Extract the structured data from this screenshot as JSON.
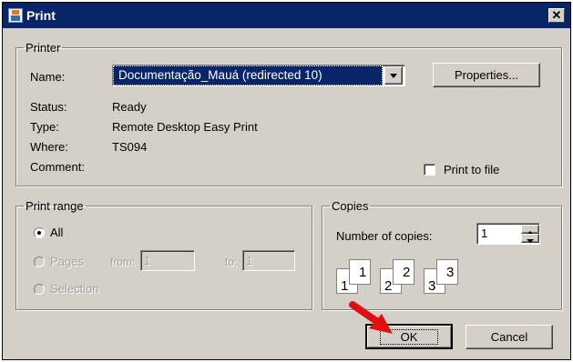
{
  "window": {
    "title": "Print",
    "close_glyph": "✕"
  },
  "printer": {
    "legend": "Printer",
    "name_label": "Name:",
    "name_value": "Documentação_Mauá (redirected 10)",
    "properties_button": "Properties...",
    "status_label": "Status:",
    "status_value": "Ready",
    "type_label": "Type:",
    "type_value": "Remote Desktop Easy Print",
    "where_label": "Where:",
    "where_value": "TS094",
    "comment_label": "Comment:",
    "print_to_file": "Print to file"
  },
  "print_range": {
    "legend": "Print range",
    "all": "All",
    "pages": "Pages",
    "from_label": "from:",
    "from_value": "1",
    "to_label": "to:",
    "to_value": "1",
    "selection": "Selection"
  },
  "copies": {
    "legend": "Copies",
    "number_label": "Number of copies:",
    "number_value": "1",
    "collate_pages": [
      "1",
      "1",
      "2",
      "2",
      "3",
      "3"
    ]
  },
  "buttons": {
    "ok": "OK",
    "cancel": "Cancel"
  },
  "colors": {
    "titlebar": "#0a246a",
    "dialog_bg": "#d4d0c8",
    "arrow": "#e01010"
  },
  "icons": {
    "window": "java-cup-icon",
    "dropdown": "chevron-down-icon",
    "pointer": "red-arrow-icon"
  }
}
